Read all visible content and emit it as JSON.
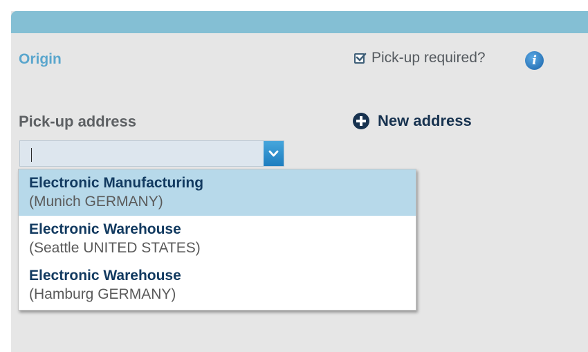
{
  "origin": {
    "title": "Origin",
    "pickup_required_label": "Pick-up required?",
    "pickup_required_checked": true,
    "info_icon": "info-icon",
    "info_glyph": "i"
  },
  "address": {
    "label": "Pick-up address",
    "new_address_label": "New address",
    "new_address_icon": "plus-circle-icon",
    "input_value": ""
  },
  "dropdown": {
    "options": [
      {
        "name": "Electronic Manufacturing",
        "location": "(Munich GERMANY)",
        "highlighted": true
      },
      {
        "name": "Electronic Warehouse",
        "location": "(Seattle UNITED STATES)",
        "highlighted": false
      },
      {
        "name": "Electronic Warehouse",
        "location": "(Hamburg GERMANY)",
        "highlighted": false
      }
    ]
  },
  "colors": {
    "header_bar": "#84bfd4",
    "panel_background": "#e6e6e6",
    "origin_title": "#5aa6cd",
    "highlight": "#b7d9ea",
    "option_name": "#123a60"
  }
}
